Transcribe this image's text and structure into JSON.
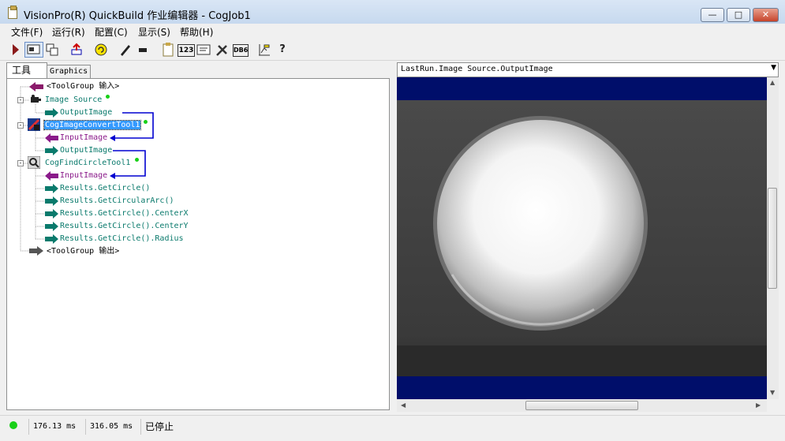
{
  "window": {
    "title": "VisionPro(R) QuickBuild 作业编辑器 - CogJob1",
    "min_glyph": "—",
    "max_glyph": "□",
    "close_glyph": "✕"
  },
  "menu": [
    "文件(F)",
    "运行(R)",
    "配置(C)",
    "显示(S)",
    "帮助(H)"
  ],
  "toolbar": {
    "icons": [
      "run-icon",
      "view-toggle-icon",
      "copy-icon",
      "import-icon",
      "reset-icon",
      "edit-icon",
      "link-icon",
      "clipboard-icon",
      "counter-icon",
      "terminal-icon",
      "tools-icon",
      "database-icon",
      "chart-icon",
      "help-icon"
    ],
    "counter_label": "123",
    "db_label": "DB6"
  },
  "tabs": {
    "tools": "工具",
    "graphics": "Graphics"
  },
  "tree": {
    "group_input": "<ToolGroup 输入>",
    "image_source": "Image Source",
    "image_source_output": "OutputImage",
    "convert_tool": "CogImageConvertTool1",
    "convert_input": "InputImage",
    "convert_output": "OutputImage",
    "find_tool": "CogFindCircleTool1",
    "find_input": "InputImage",
    "results": [
      "Results.GetCircle()",
      "Results.GetCircularArc()",
      "Results.GetCircle().CenterX",
      "Results.GetCircle().CenterY",
      "Results.GetCircle().Radius"
    ],
    "group_output": "<ToolGroup 输出>"
  },
  "image_panel": {
    "selected_image": "LastRun.Image Source.OutputImage",
    "dropdown_arrow": "▼"
  },
  "status": {
    "indicator_color": "#18d018",
    "time1": "176.13 ms",
    "time2": "316.05 ms",
    "state": "已停止"
  },
  "colors": {
    "tool_text": "#0a7a6c",
    "input_text": "#8a1a8a",
    "selection": "#3399ff",
    "link_line": "#0000d0",
    "image_background": "#000e6a"
  }
}
